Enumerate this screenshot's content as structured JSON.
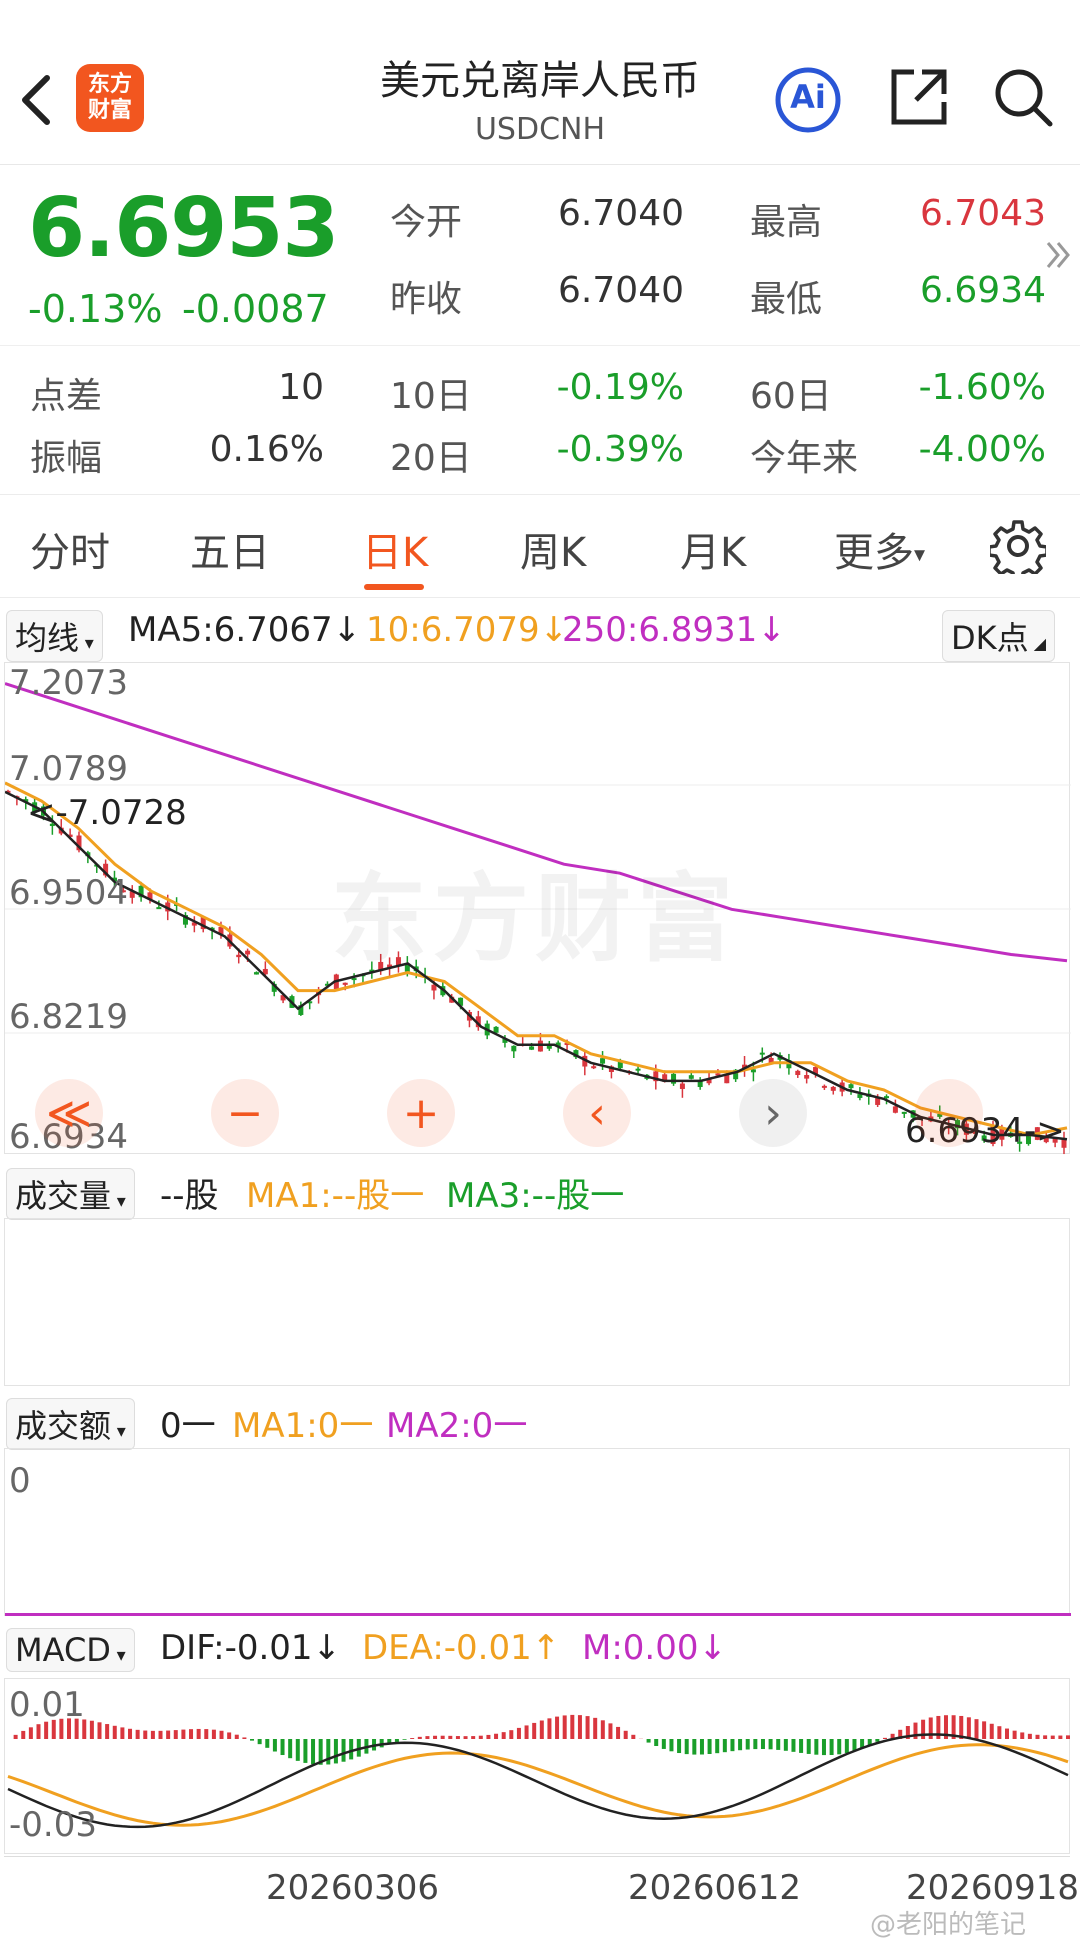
{
  "header": {
    "back_icon": "chevron-left-icon",
    "logo_text": "东方财富",
    "title": "美元兑离岸人民币",
    "subtitle": "USDCNH",
    "ai_label": "Ai",
    "share_icon": "share-icon",
    "search_icon": "search-icon"
  },
  "quote": {
    "price": "6.6953",
    "change_pct": "-0.13%",
    "change": "-0.0087",
    "open_label": "今开",
    "open": "6.7040",
    "prev_label": "昨收",
    "prev": "6.7040",
    "high_label": "最高",
    "high": "6.7043",
    "low_label": "最低",
    "low": "6.6934",
    "spread_label": "点差",
    "spread": "10",
    "d10_label": "10日",
    "d10": "-0.19%",
    "d60_label": "60日",
    "d60": "-1.60%",
    "amp_label": "振幅",
    "amp": "0.16%",
    "d20_label": "20日",
    "d20": "-0.39%",
    "ytd_label": "今年来",
    "ytd": "-4.00%",
    "more_icon": "double-chevron-right-icon"
  },
  "tabs": [
    {
      "label": "分时"
    },
    {
      "label": "五日"
    },
    {
      "label": "日K"
    },
    {
      "label": "周K"
    },
    {
      "label": "月K"
    },
    {
      "label": "更多"
    }
  ],
  "settings_icon": "gear-icon",
  "ma_legend": {
    "selector": "均线",
    "ma5": "MA5:6.7067↓",
    "ma10": "10:6.7079↓",
    "ma250": "250:6.8931↓",
    "dk_button": "DK点"
  },
  "kline_axis": {
    "y1": "7.2073",
    "y2": "7.0789",
    "y3": "6.9504",
    "y4": "6.8219",
    "y5": "6.6934",
    "high_marker": "7.0728",
    "low_marker": "6.6934"
  },
  "controls": [
    "≪",
    "−",
    "+",
    "‹",
    "›"
  ],
  "watermark": "东方财富",
  "volume": {
    "selector": "成交量",
    "value": "--股",
    "ma1": "MA1:--股一",
    "ma3": "MA3:--股一"
  },
  "amount": {
    "selector": "成交额",
    "value": "0一",
    "ma1": "MA1:0一",
    "ma2": "MA2:0一",
    "axis_zero": "0"
  },
  "macd": {
    "selector": "MACD",
    "dif": "DIF:-0.01↓",
    "dea": "DEA:-0.01↑",
    "m": "M:0.00↓",
    "y_top": "0.01",
    "y_bottom": "-0.03"
  },
  "x_axis": {
    "d1": "20260306",
    "d2": "20260612",
    "d3": "20260918"
  },
  "footer_watermark": "@老阳的笔记",
  "colors": {
    "up": "#d9363e",
    "down": "#1a9e2a",
    "ma5": "#222222",
    "ma10": "#f0a020",
    "ma250": "#c02ec0",
    "accent": "#f2561f"
  },
  "chart_data": {
    "type": "line",
    "title": "",
    "xlabel": "",
    "ylabel": "",
    "x_ticks": [
      "20260306",
      "20260612",
      "20260918"
    ],
    "ylim": [
      6.6934,
      7.2073
    ],
    "series": [
      {
        "name": "MA5",
        "values": [
          7.08,
          7.06,
          7.02,
          6.98,
          6.96,
          6.94,
          6.92,
          6.88,
          6.84,
          6.87,
          6.88,
          6.89,
          6.86,
          6.82,
          6.8,
          6.8,
          6.78,
          6.77,
          6.76,
          6.76,
          6.77,
          6.79,
          6.77,
          6.75,
          6.74,
          6.72,
          6.71,
          6.7,
          6.7,
          6.6953
        ]
      },
      {
        "name": "10",
        "values": [
          7.09,
          7.07,
          7.04,
          7.0,
          6.97,
          6.95,
          6.93,
          6.9,
          6.86,
          6.86,
          6.87,
          6.88,
          6.87,
          6.84,
          6.81,
          6.81,
          6.79,
          6.78,
          6.77,
          6.77,
          6.77,
          6.78,
          6.78,
          6.76,
          6.75,
          6.73,
          6.72,
          6.71,
          6.7,
          6.7079
        ]
      },
      {
        "name": "250",
        "values": [
          7.2,
          7.18,
          7.16,
          7.14,
          7.12,
          7.1,
          7.08,
          7.06,
          7.04,
          7.02,
          7.0,
          6.99,
          6.97,
          6.95,
          6.94,
          6.93,
          6.92,
          6.91,
          6.9,
          6.8931
        ]
      }
    ]
  }
}
